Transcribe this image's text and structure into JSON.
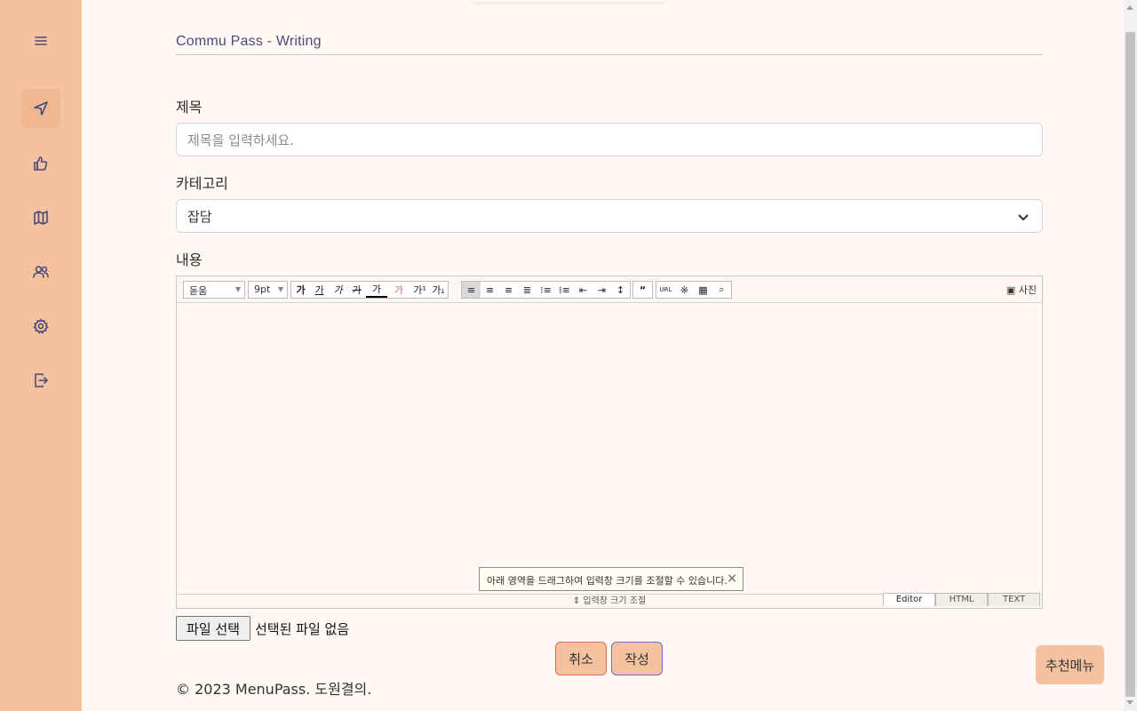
{
  "sidebar": {
    "items": [
      {
        "name": "menu-icon"
      },
      {
        "name": "navigation-icon"
      },
      {
        "name": "thumbs-up-icon"
      },
      {
        "name": "map-icon"
      },
      {
        "name": "users-icon"
      },
      {
        "name": "settings-icon"
      },
      {
        "name": "logout-icon"
      }
    ]
  },
  "page": {
    "title": "Commu Pass - Writing"
  },
  "form": {
    "title_label": "제목",
    "title_placeholder": "제목을 입력하세요.",
    "category_label": "카테고리",
    "category_value": "잡담",
    "content_label": "내용"
  },
  "editor": {
    "font_family": "돋움",
    "font_size": "9pt",
    "photo_label": "사진",
    "tooltip_text": "아래 영역을 드래그하여 입력창 크기를 조절할 수 있습니다.",
    "resize_label": "입력창 크기 조절",
    "modes": [
      "Editor",
      "HTML",
      "TEXT"
    ],
    "text_buttons": [
      "가",
      "가",
      "가",
      "가",
      "가",
      "가",
      "가¹",
      "가₁"
    ],
    "quote_glyph": "“",
    "url_label": "URL"
  },
  "file": {
    "button_label": "파일 선택",
    "status": "선택된 파일 없음"
  },
  "actions": {
    "cancel_label": "취소",
    "submit_label": "작성"
  },
  "footer": {
    "copyright": "© 2023 MenuPass. 도원결의."
  },
  "floating": {
    "recommend_label": "추천메뉴"
  },
  "colors": {
    "sidebar_bg": "#f4c29e",
    "page_bg": "#fff8f4",
    "accent_text": "#4a4a7a"
  }
}
